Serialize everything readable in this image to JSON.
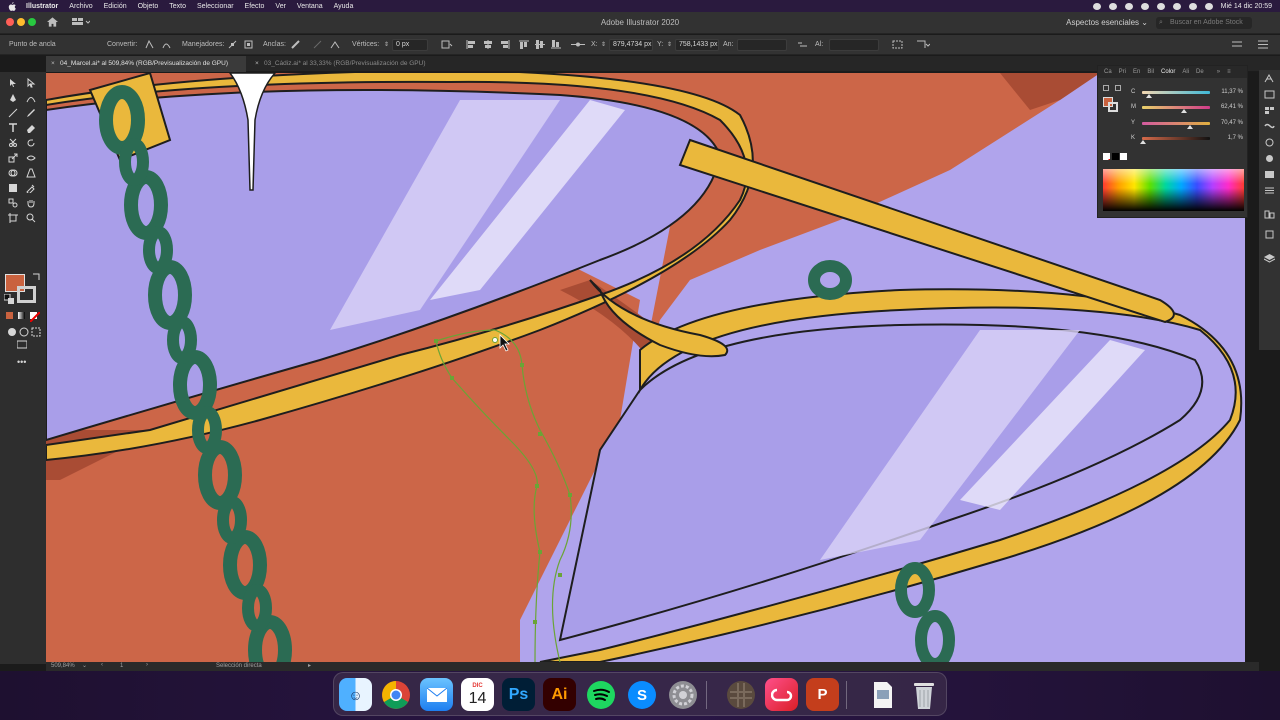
{
  "menubar": {
    "items": [
      "Illustrator",
      "Archivo",
      "Edición",
      "Objeto",
      "Texto",
      "Seleccionar",
      "Efecto",
      "Ver",
      "Ventana",
      "Ayuda"
    ],
    "clock": "Mié 14 dic  20:59"
  },
  "titlebar": {
    "title": "Adobe Illustrator 2020",
    "workspace": "Aspectos esenciales",
    "search_placeholder": "Buscar en Adobe Stock"
  },
  "control": {
    "anchor_label": "Punto de ancla",
    "convert_label": "Convertir:",
    "handles_label": "Manejadores:",
    "anchors_label": "Anclas:",
    "corners_label": "Vértices:",
    "corners_value": "0 px",
    "x_label": "X:",
    "x_value": "879,4734 px",
    "y_label": "Y:",
    "y_value": "758,1433 px",
    "w_label": "An:",
    "h_label": "Al:"
  },
  "tabs": [
    {
      "label": "04_Marcel.ai* al 509,84% (RGB/Previsualización de GPU)",
      "active": true
    },
    {
      "label": "03_Cádiz.ai* al 33,33% (RGB/Previsualización de GPU)",
      "active": false
    }
  ],
  "color_panel": {
    "tabs": [
      "Ca",
      "Pri",
      "En",
      "Bil",
      "Color",
      "Ali",
      "De"
    ],
    "active_tab": "Color",
    "rows": [
      {
        "key": "C",
        "value": "11,37",
        "unit": "%",
        "fraction": 0.11,
        "gradient": "linear-gradient(to right,#f3d6b0,#3fb9d8)"
      },
      {
        "key": "M",
        "value": "62,41",
        "unit": "%",
        "fraction": 0.62,
        "gradient": "linear-gradient(to right,#e8d16a,#d03a8a)"
      },
      {
        "key": "Y",
        "value": "70,47",
        "unit": "%",
        "fraction": 0.7,
        "gradient": "linear-gradient(to right,#d35aa0,#e0b040)"
      },
      {
        "key": "K",
        "value": "1,7",
        "unit": "%",
        "fraction": 0.02,
        "gradient": "linear-gradient(to right,#d66a4a,#111)"
      }
    ]
  },
  "status": {
    "zoom": "509,84%",
    "artboard": "1",
    "tool": "Selección directa"
  },
  "dock": {
    "calendar_month": "DIC",
    "calendar_day": "14",
    "ai_label": "Ai",
    "ps_label": "Ps",
    "items": [
      "finder",
      "chrome",
      "mail",
      "calendar",
      "photoshop",
      "illustrator",
      "spotify",
      "shazam",
      "settings",
      "photo",
      "creative-cloud",
      "powerpoint",
      "file",
      "trash"
    ]
  },
  "colors": {
    "accent_fill": "#c9623f",
    "lens": "#a89de8",
    "frame": "#eab83c",
    "chain": "#2b6b53",
    "background_art": "#cc6648"
  }
}
